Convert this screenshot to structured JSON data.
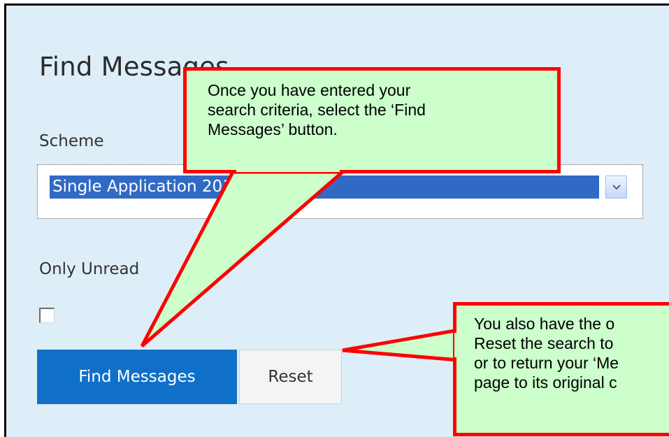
{
  "page": {
    "title": "Find Messages",
    "scheme_label": "Scheme",
    "scheme_value": "Single Application 2013",
    "only_unread_label": "Only Unread",
    "only_unread_checked": false,
    "find_button": "Find Messages",
    "reset_button": "Reset"
  },
  "callouts": {
    "find": {
      "line1": "Once you have entered your",
      "line2": "search criteria, select the ‘Find",
      "line3": "Messages’ button."
    },
    "reset": {
      "line1": "You also have the o",
      "line2": "Reset the search to",
      "line3": "or to return your ‘Me",
      "line4": "page to its original c"
    }
  },
  "colors": {
    "page_bg": "#deeef8",
    "select_highlight": "#316ac5",
    "primary_button": "#1070c9",
    "callout_fill": "#ccffcc",
    "callout_border": "#ff0000"
  },
  "icons": {
    "select_arrow": "chevron-down-icon"
  }
}
